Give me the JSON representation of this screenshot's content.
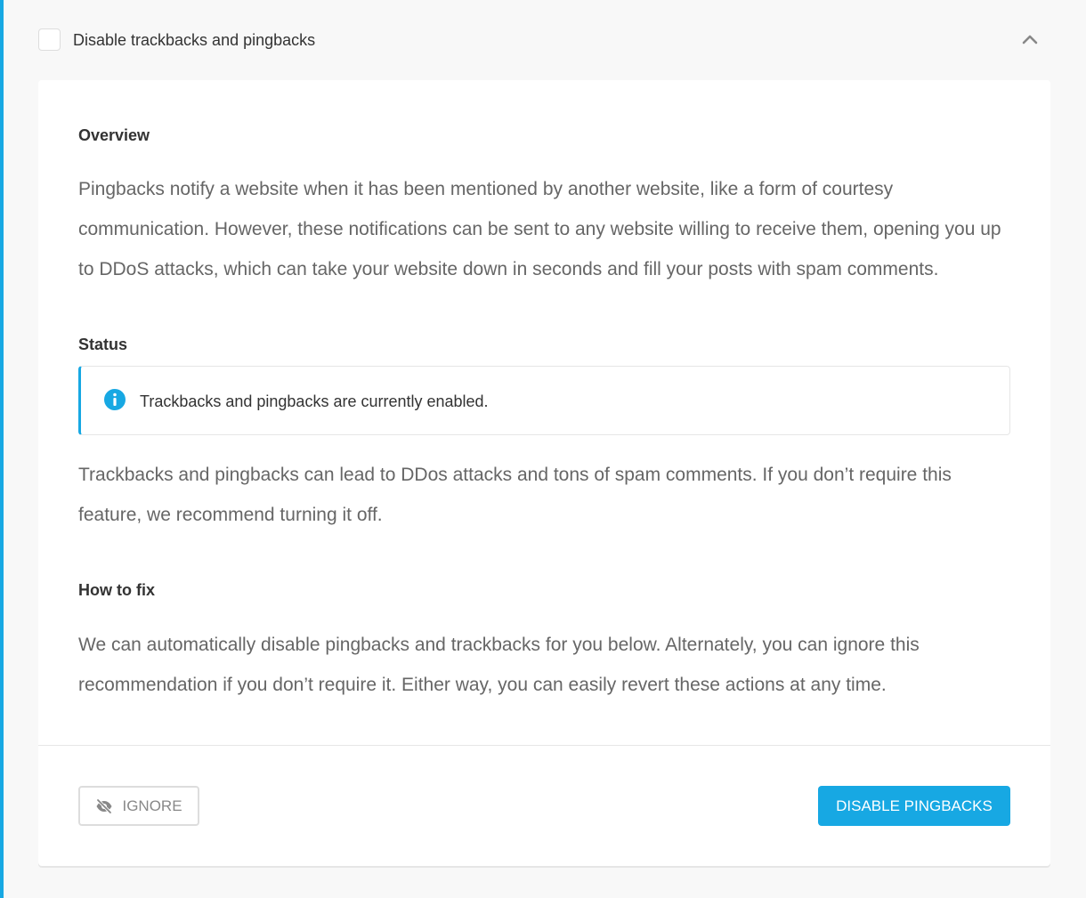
{
  "header": {
    "title": "Disable trackbacks and pingbacks"
  },
  "overview": {
    "heading": "Overview",
    "text": "Pingbacks notify a website when it has been mentioned by another website, like a form of courtesy communication. However, these notifications can be sent to any website willing to receive them, opening you up to DDoS attacks, which can take your website down in seconds and fill your posts with spam comments."
  },
  "status": {
    "heading": "Status",
    "notice": "Trackbacks and pingbacks are currently enabled.",
    "text": "Trackbacks and pingbacks can lead to DDos attacks and tons of spam comments. If you don’t require this feature, we recommend turning it off."
  },
  "how_to_fix": {
    "heading": "How to fix",
    "text": "We can automatically disable pingbacks and trackbacks for you below. Alternately, you can ignore this recommendation if you don’t require it. Either way, you can easily revert these actions at any time."
  },
  "footer": {
    "ignore_label": "IGNORE",
    "primary_label": "DISABLE PINGBACKS"
  },
  "icons": {
    "info": "info-icon",
    "ignore": "eye-slash-icon",
    "collapse": "chevron-up-icon"
  },
  "colors": {
    "accent": "#17a8e3",
    "background": "#f8f8f8",
    "text_dark": "#333333",
    "text_muted": "#666666"
  }
}
